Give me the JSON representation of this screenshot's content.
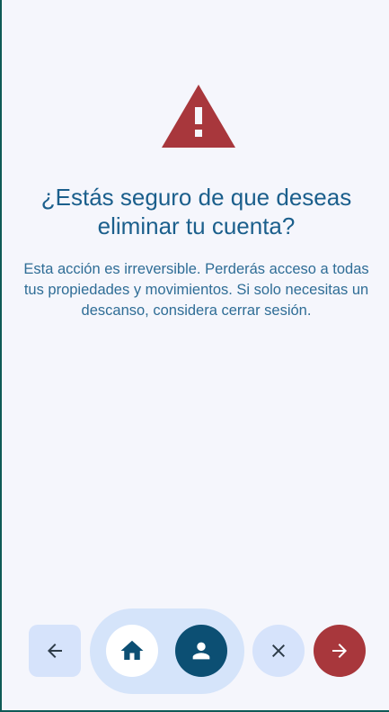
{
  "dialog": {
    "title": "¿Estás seguro de que deseas eliminar tu cuenta?",
    "description": "Esta acción es irreversible. Perderás acceso a todas tus propiedades y movimientos. Si solo necesitas un descanso, considera cerrar sesión.",
    "icon": "warning-icon"
  },
  "nav": {
    "back_icon": "arrow-left-icon",
    "home_icon": "home-icon",
    "profile_icon": "person-icon",
    "close_icon": "close-icon",
    "next_icon": "arrow-right-icon"
  },
  "colors": {
    "background": "#f5f6fc",
    "warning": "#a8373c",
    "text": "#1b5f8c",
    "accent_dark": "#0c4f73",
    "pill": "#d5e4fa",
    "border": "#0f5a57"
  }
}
